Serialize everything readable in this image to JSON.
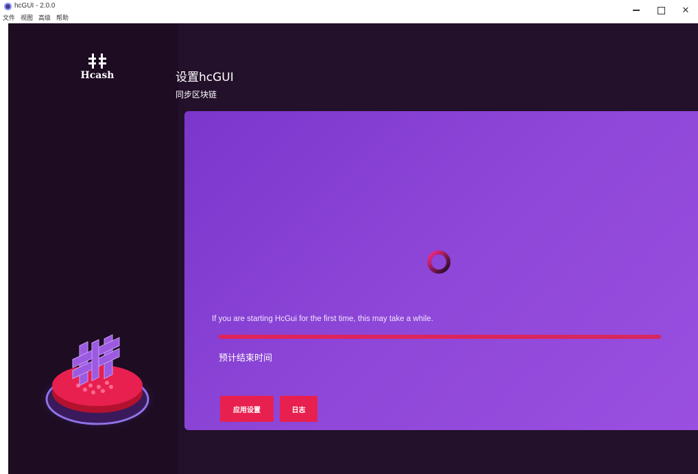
{
  "window": {
    "title": "hcGUI - 2.0.0",
    "menu": [
      "文件",
      "视图",
      "高级",
      "帮助"
    ],
    "controls": {
      "minimize": "–",
      "maximize": "□",
      "close": "✕"
    }
  },
  "sidebar": {
    "logo_text": "Hcash"
  },
  "page": {
    "title": "设置hcGUI",
    "subtitle": "同步区块链"
  },
  "sync": {
    "message": "If you are starting HcGui for the first time, this may take a while.",
    "progress": 1.0,
    "eta_label": "预计结束时间"
  },
  "buttons": {
    "settings": "应用设置",
    "logs": "日志"
  },
  "colors": {
    "accent": "#e8204f",
    "panel": "#8a44d6",
    "background": "#23102a"
  }
}
